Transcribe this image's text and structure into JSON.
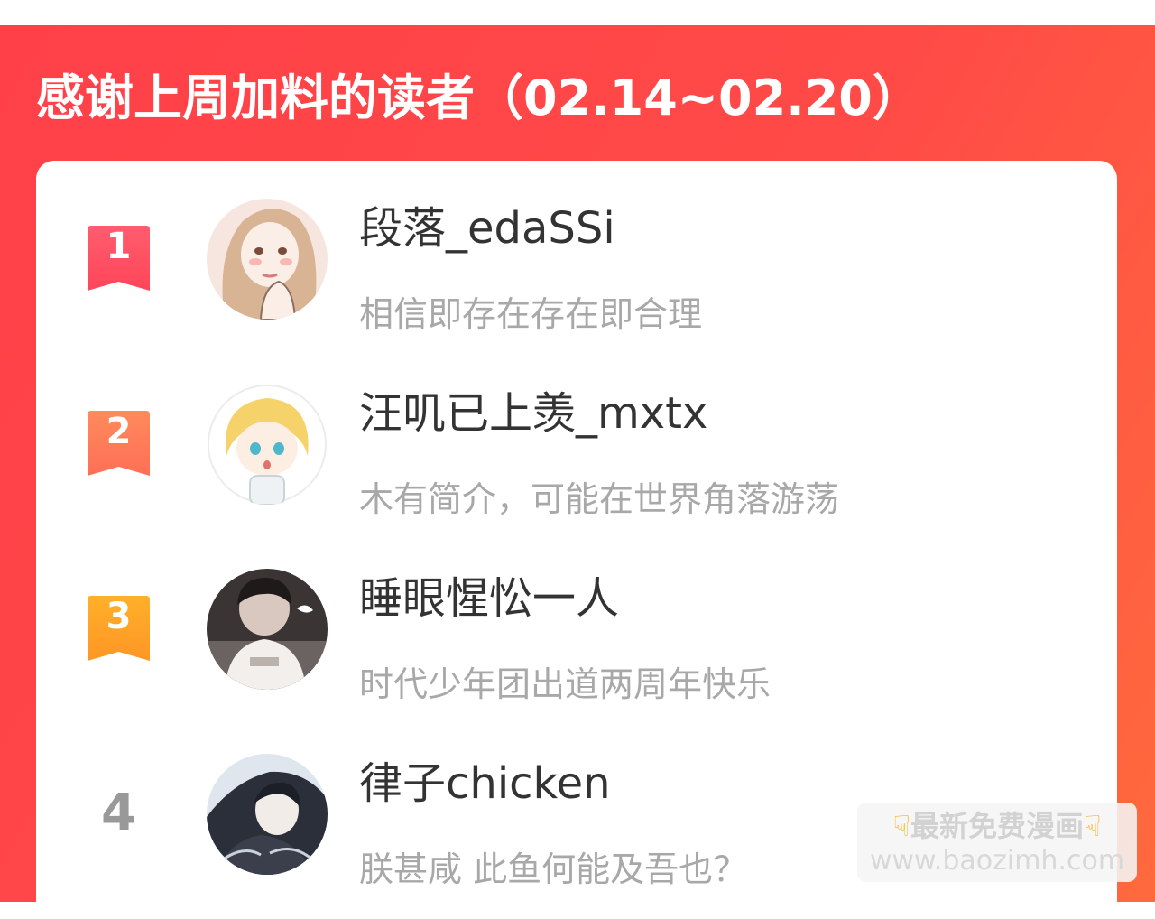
{
  "title": "感谢上周加料的读者（02.14~02.20）",
  "colors": {
    "banner": "#ff4049",
    "badge_1": "#ff5466",
    "badge_2": "#ff7d59",
    "badge_3": "#ffa22a",
    "rank_plain": "#999999",
    "username": "#333333",
    "bio": "#a8a8a8"
  },
  "readers": [
    {
      "rank": "1",
      "username": "段落_edaSSi",
      "bio": "相信即存在存在即合理",
      "avatar": "avatar-anime-girl-beige"
    },
    {
      "rank": "2",
      "username": "汪叽已上羡_mxtx",
      "bio": "木有简介，可能在世界角落游荡",
      "avatar": "avatar-chibi-blond-boy"
    },
    {
      "rank": "3",
      "username": "睡眼惺忪一人",
      "bio": "时代少年团出道两周年快乐",
      "avatar": "avatar-photo-young-man"
    },
    {
      "rank": "4",
      "username": "律子chicken",
      "bio": "朕甚咸 此鱼何能及吾也？",
      "avatar": "avatar-dark-haired-illustration"
    }
  ],
  "watermark": {
    "line1": "最新免费漫画",
    "line2": "www.baozimh.com",
    "icon": "pointing-down-hand-icon"
  }
}
